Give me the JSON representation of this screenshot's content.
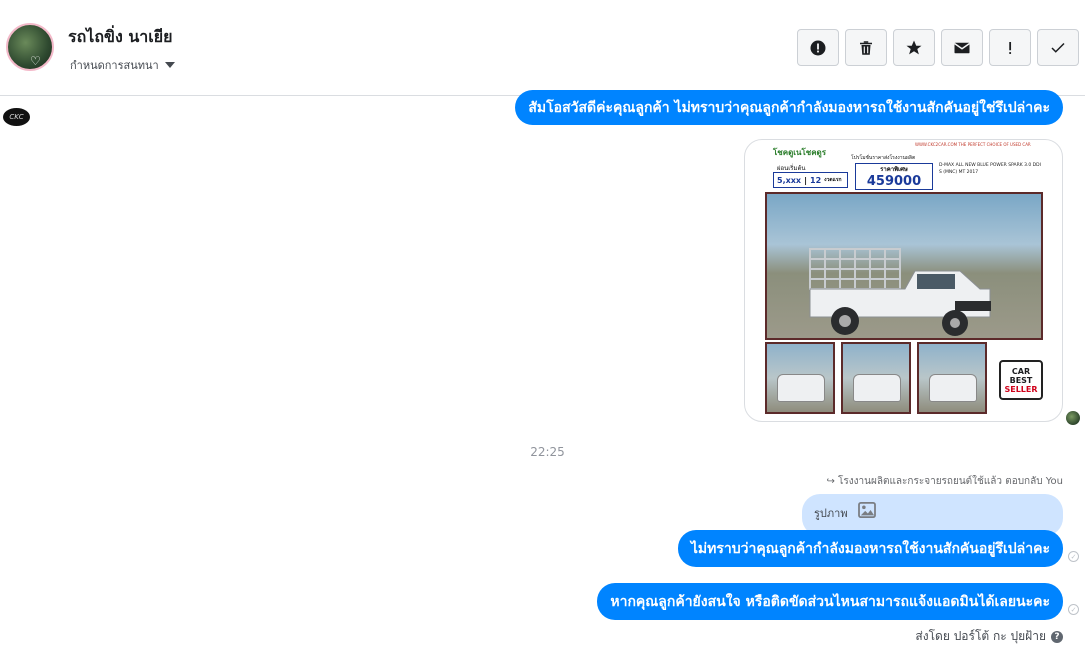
{
  "header": {
    "contact_name": "รถไถขิ่ง นาเยีย",
    "subtitle": "กำหนดการสนทนา",
    "toolbar": [
      {
        "name": "spam-button",
        "icon": "alert-circle-icon"
      },
      {
        "name": "delete-button",
        "icon": "trash-icon"
      },
      {
        "name": "star-button",
        "icon": "star-icon"
      },
      {
        "name": "mark-unread-button",
        "icon": "envelope-icon"
      },
      {
        "name": "follow-up-button",
        "icon": "exclamation-icon"
      },
      {
        "name": "done-button",
        "icon": "check-icon"
      }
    ]
  },
  "page_avatar_label": "CKC",
  "messages": {
    "first": "สัมโอสวัสดีค่ะคุณลูกค้า ไม่ทราบว่าคุณลูกค้ากำลังมองหารถใช้งานสักคันอยู่ใช่รึเปล่าคะ",
    "second": "ไม่ทราบว่าคุณลูกค้ากำลังมองหารถใช้งานสักคันอยู่รึเปล่าคะ",
    "third": "หากคุณลูกค้ายังสนใจ หรือติดขัดส่วนไหนสามารถแจ้งแอดมินได้เลยนะคะ"
  },
  "ad_image": {
    "site": "WWW.CKC2CAR.COM THE PERFECT CHOICE OF USED CAR",
    "headline": "โชคดูเนโชคดูร",
    "promo": "โปรโมชั่นราคาส่งโรงงานผลิต",
    "down_label": "ผ่อนเริ่มต้น",
    "installment": "5,xxx",
    "months": "12",
    "months_suffix": "งวดแรก",
    "price_label": "ราคาพิเศษ",
    "price": "459000",
    "model": "D-MAX ALL NEW BLUE POWER SPARK 3.0 DDI S (MNC) MT 2017",
    "badge_line1": "CAR",
    "badge_line2": "BEST",
    "badge_line3": "SELLER"
  },
  "timestamp": "22:25",
  "reply": {
    "meta": "โรงงานผลิตและกระจายรถยนต์ใช้แล้ว ตอบกลับ You",
    "quote_label": "รูปภาพ"
  },
  "sent_by": "ส่งโดย ปอร์โต้ กะ ปุยฝ้าย",
  "colors": {
    "bubble": "#0084ff",
    "quote": "#cfe4ff",
    "border": "#dadde1"
  }
}
